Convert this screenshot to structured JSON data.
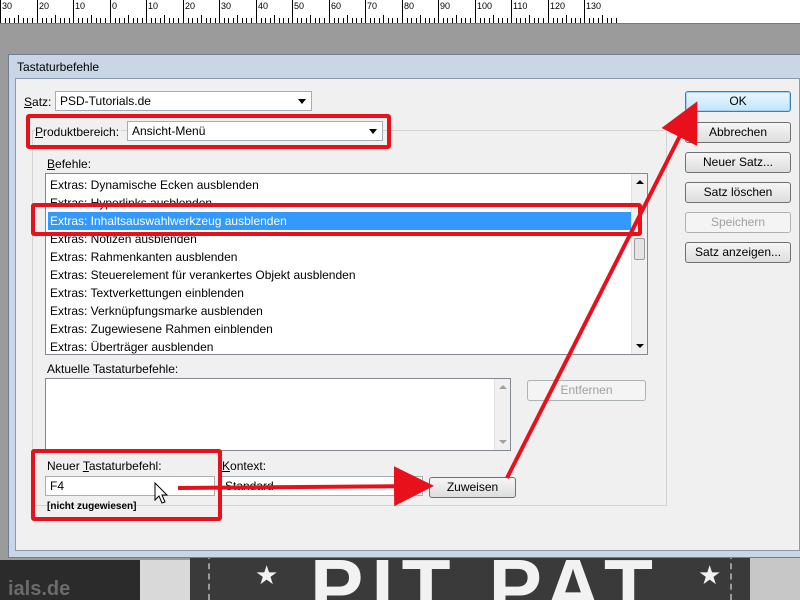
{
  "ruler": {
    "labels": [
      "30",
      "20",
      "10",
      "0",
      "10",
      "20",
      "30",
      "40",
      "50",
      "60",
      "70",
      "80",
      "90",
      "100",
      "110",
      "120",
      "130"
    ]
  },
  "background": {
    "watermark": "ials.de",
    "poster_text": "PIT PAT",
    "star": "★"
  },
  "dialog": {
    "title": "Tastaturbefehle",
    "satz": {
      "label_u": "S",
      "label_rest": "atz:",
      "value": "PSD-Tutorials.de"
    },
    "produktbereich": {
      "label_u": "P",
      "label_rest": "roduktbereich:",
      "value": "Ansicht-Menü"
    },
    "befehle": {
      "label_u": "B",
      "label_rest": "efehle:",
      "items": [
        "Extras: Dynamische Ecken ausblenden",
        "Extras: Hyperlinks ausblenden",
        "Extras: Inhaltsauswahlwerkzeug ausblenden",
        "Extras: Notizen ausblenden",
        "Extras: Rahmenkanten ausblenden",
        "Extras: Steuerelement für verankertes Objekt ausblenden",
        "Extras: Textverkettungen einblenden",
        "Extras: Verknüpfungsmarke ausblenden",
        "Extras: Zugewiesene Rahmen einblenden",
        "Extras: Überträger ausblenden"
      ],
      "selected_index": 2
    },
    "aktuelle": {
      "label": "Aktuelle Tastaturbefehle:",
      "entfernen": "Entfernen"
    },
    "neuer": {
      "label_a": "Neuer ",
      "label_u": "T",
      "label_rest": "astaturbefehl:",
      "value": "F4",
      "status": "[nicht zugewiesen]"
    },
    "kontext": {
      "label_u": "K",
      "label_rest": "ontext:",
      "value": "Standard"
    },
    "zuweisen": "Zuweisen",
    "buttons": {
      "ok": "OK",
      "abbrechen": "Abbrechen",
      "neuer_satz": "Neuer Satz...",
      "satz_loeschen": "Satz löschen",
      "speichern": "Speichern",
      "satz_anzeigen": "Satz anzeigen..."
    }
  },
  "colors": {
    "annotation_red": "#e8101a",
    "selection_blue": "#3399ff"
  },
  "icons": {
    "mouse_cursor": "arrow-cursor-icon"
  }
}
